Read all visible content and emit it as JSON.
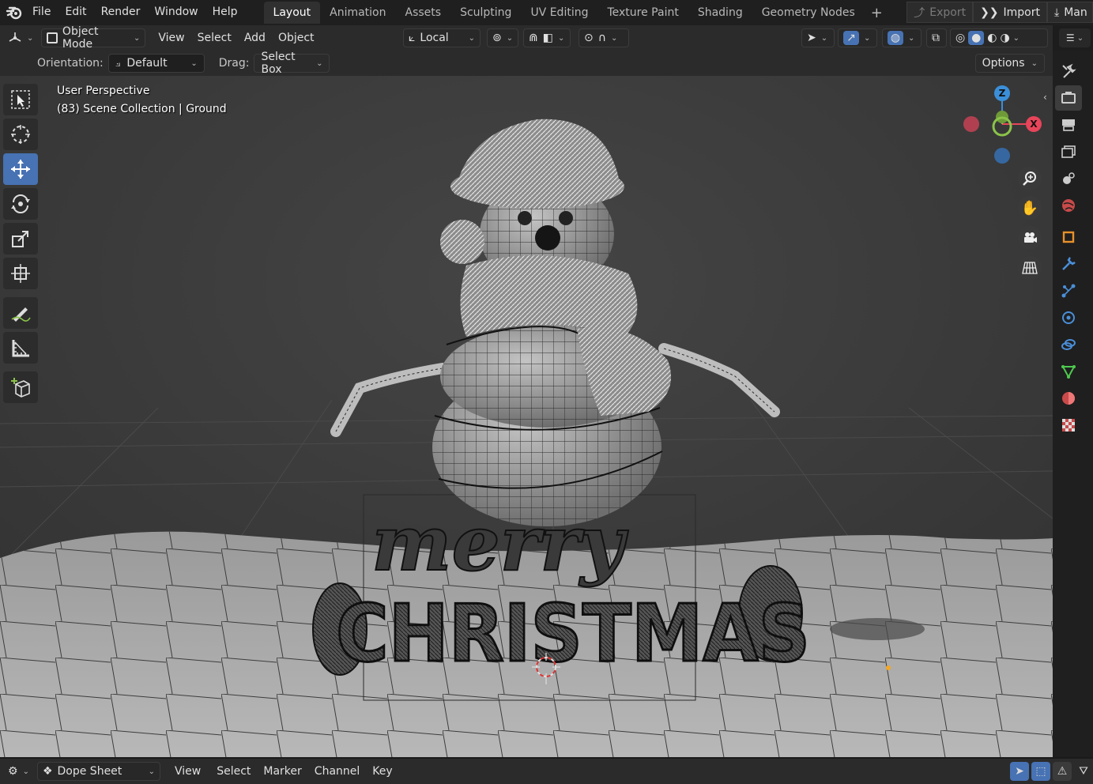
{
  "topbar": {
    "menus": [
      "File",
      "Edit",
      "Render",
      "Window",
      "Help"
    ],
    "workspaces": [
      "Layout",
      "Animation",
      "Assets",
      "Sculpting",
      "UV Editing",
      "Texture Paint",
      "Shading",
      "Geometry Nodes"
    ],
    "active_workspace": "Layout",
    "right_buttons": {
      "export": "Export",
      "import": "Import",
      "manual": "Man"
    }
  },
  "header": {
    "mode": "Object Mode",
    "menus": [
      "View",
      "Select",
      "Add",
      "Object"
    ],
    "transform_orientation": "Local"
  },
  "tool_settings": {
    "orientation_label": "Orientation:",
    "orientation_value": "Default",
    "drag_label": "Drag:",
    "drag_value": "Select Box",
    "options": "Options"
  },
  "viewport": {
    "perspective": "User Perspective",
    "collection": "(83) Scene Collection | Ground",
    "scene_text_top": "merry",
    "scene_text_bottom": "CHRISTMAS",
    "axes": {
      "x": "X",
      "y": "Y",
      "z": "Z"
    }
  },
  "bottombar": {
    "editor": "Dope Sheet",
    "menus": [
      "View",
      "Select",
      "Marker",
      "Channel",
      "Key"
    ]
  },
  "colors": {
    "accent": "#4772b3",
    "axis_x": "#e8455a",
    "axis_y": "#8bc34a",
    "axis_z": "#3b8fd9"
  }
}
